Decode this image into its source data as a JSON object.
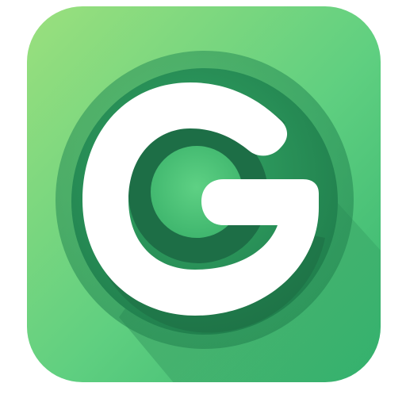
{
  "icon": {
    "name": "g-logo-app-icon",
    "letter": "G",
    "colors": {
      "page_background": "#ffffff",
      "tile_gradient_start": "#9be07e",
      "tile_gradient_mid": "#5fcf80",
      "tile_gradient_end": "#34b46f",
      "ring_outer": "#2f9a5e",
      "ring_mid": "#238a55",
      "ring_inner": "#1d6e46",
      "inner_disc": "#4cc274",
      "long_shadow": "#1f7a4c",
      "glyph": "#ffffff"
    }
  }
}
